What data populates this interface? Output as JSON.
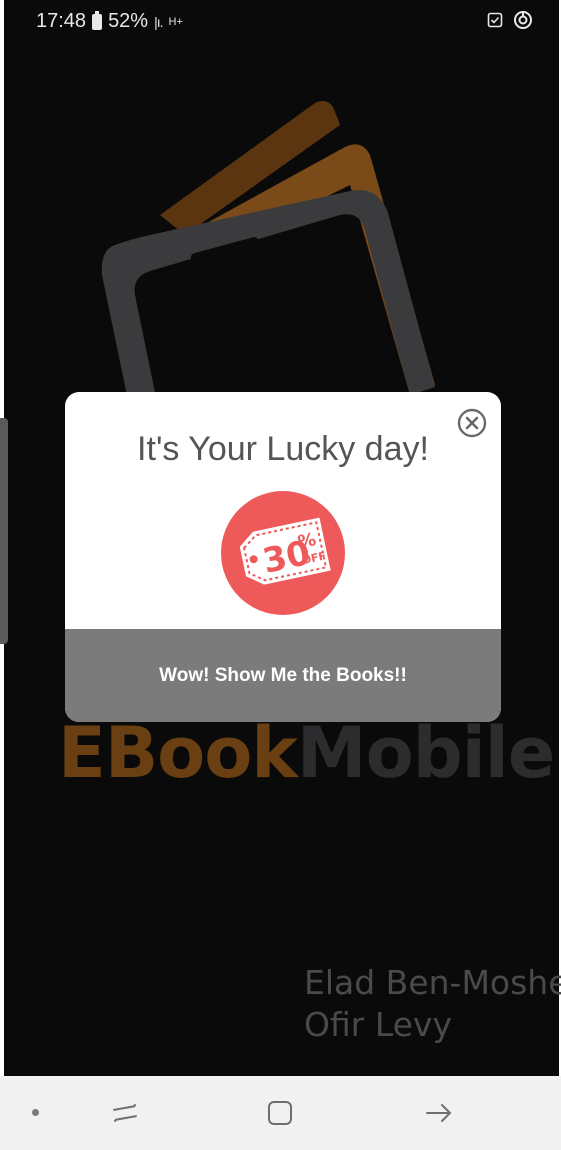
{
  "status_bar": {
    "time": "17:48",
    "battery": "52%",
    "signal": "|ı.",
    "network": "H+"
  },
  "splash": {
    "brand_part1": "EBook",
    "brand_part2": "Mobile",
    "credits": [
      "Elad Ben-Moshe",
      "Ofir Levy"
    ],
    "colors": {
      "brand_brown": "#6a3f12",
      "brand_gray": "#2c2c2e",
      "background": "#0a0a0a"
    }
  },
  "popup": {
    "title": "It's Your Lucky day!",
    "badge": {
      "value": "30",
      "percent": "%",
      "suffix": "OFF",
      "color": "#ee5a5a"
    },
    "action_label": "Wow! Show Me the Books!!",
    "close_icon": "close-circle-icon"
  },
  "nav_bar": {
    "icons": [
      "dot-icon",
      "recents-icon",
      "home-icon",
      "back-icon"
    ]
  }
}
